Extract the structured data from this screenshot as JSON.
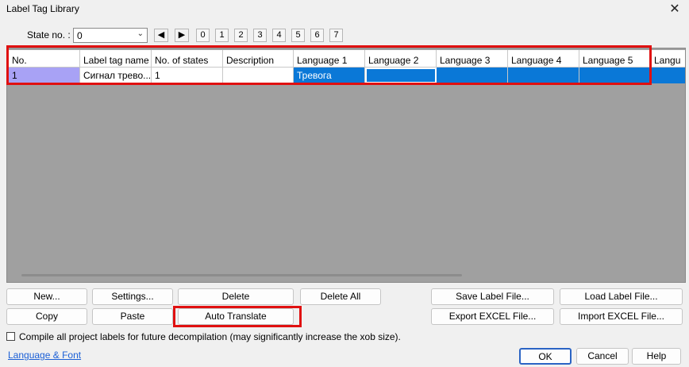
{
  "window": {
    "title": "Label Tag Library",
    "close_symbol": "✕"
  },
  "state": {
    "label": "State no. :",
    "selected": "0",
    "prev_symbol": "◀",
    "next_symbol": "▶",
    "numbers": [
      "0",
      "1",
      "2",
      "3",
      "4",
      "5",
      "6",
      "7"
    ]
  },
  "table": {
    "headers": [
      "No.",
      "Label tag name",
      "No. of states",
      "Description",
      "Language 1",
      "Language 2",
      "Language 3",
      "Language 4",
      "Language 5",
      "Langu"
    ],
    "rows": [
      [
        "1",
        "Сигнал трево...",
        "1",
        "",
        "Тревога",
        "",
        "",
        "",
        "",
        ""
      ]
    ],
    "selection_color": "#0a78d7",
    "number_cell_color": "#a8a2f5"
  },
  "buttons": {
    "new": "New...",
    "settings": "Settings...",
    "delete": "Delete",
    "delete_all": "Delete All",
    "copy": "Copy",
    "paste": "Paste",
    "auto_translate": "Auto Translate",
    "save_label_file": "Save Label File...",
    "load_label_file": "Load Label File...",
    "export_excel": "Export EXCEL File...",
    "import_excel": "Import EXCEL File...",
    "ok": "OK",
    "cancel": "Cancel",
    "help": "Help"
  },
  "compile_option": {
    "label": "Compile all project labels for future decompilation (may significantly increase the xob size).",
    "checked": false
  },
  "language_link": "Language & Font",
  "highlight_color": "#e01010"
}
